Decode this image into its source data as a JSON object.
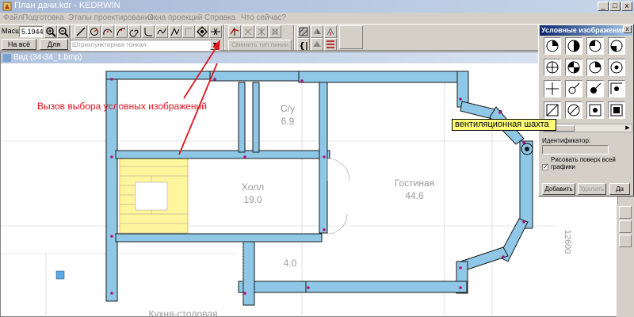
{
  "window": {
    "title": "План дачи.kdr - KEDRWIN",
    "minimize": "_",
    "maximize": "□",
    "close": "x"
  },
  "menu": {
    "items": [
      "Файл",
      "Подготовка",
      "Этапы проектирования",
      "Окна проекций",
      "Справка",
      "Что сейчас?"
    ]
  },
  "toolbar": {
    "scale_label": "Масшт",
    "scale_value": "5.1944",
    "to_window": "На всё окно",
    "for_all": "Для всех",
    "line_type": "Штрихпунктирная тонкая",
    "change_line": "Сменить тип линии"
  },
  "view": {
    "title": "Вид (34-34_1.bmp)"
  },
  "annotation": "Вызов выбора условных изображений",
  "plan": {
    "rooms": [
      {
        "name": "С/у",
        "area": "6.9"
      },
      {
        "name": "Холл",
        "area": "19.0"
      },
      {
        "name": "Гостиная",
        "area": "44.6"
      },
      {
        "area": "4.0"
      },
      {
        "name": "Кухня-столовая"
      }
    ],
    "dimension": "12600",
    "colors": {
      "wall": "#8ec8e6",
      "stair": "#fff59d",
      "outline": "#1a1a1a",
      "node": "#b0127a"
    }
  },
  "symbols_panel": {
    "title": "Условные изображения",
    "close": "x",
    "identifier_label": "Идентификатор:",
    "draw_over_label": "Рисовать поверх всей графики",
    "checked": true,
    "add": "Добавить",
    "delete": "Удалить",
    "ok": "Да"
  },
  "tooltip": "вентиляционная шахта"
}
